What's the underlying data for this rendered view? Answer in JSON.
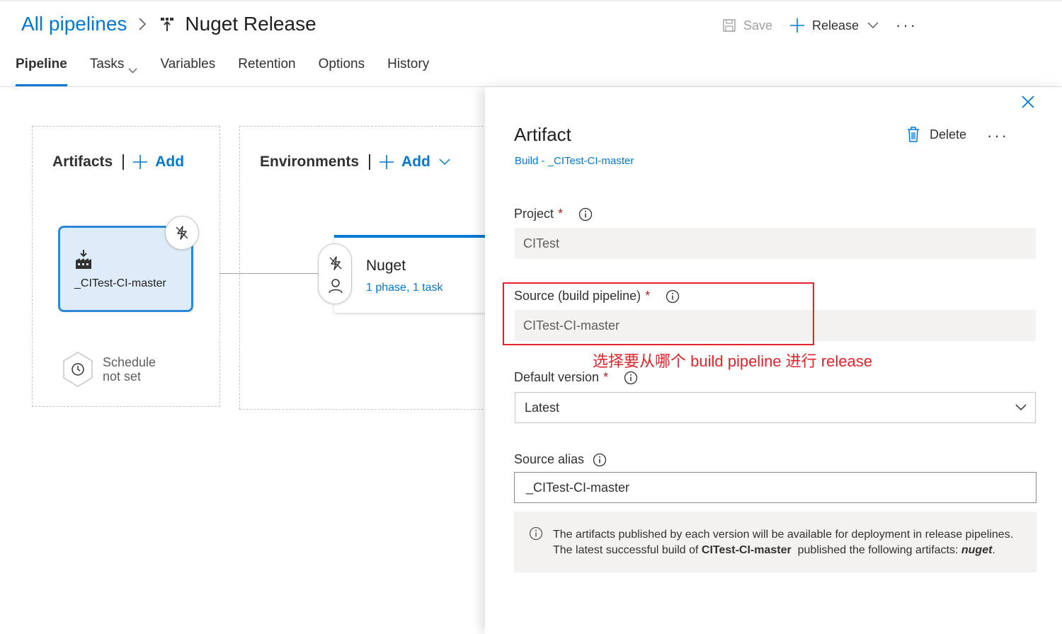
{
  "breadcrumb": {
    "root": "All pipelines",
    "title": "Nuget Release",
    "title_icon": "release-pipeline-icon"
  },
  "toolbar": {
    "save_label": "Save",
    "release_label": "Release",
    "more_label": "···"
  },
  "tabs": [
    {
      "label": "Pipeline",
      "active": true
    },
    {
      "label": "Tasks",
      "active": false,
      "dropdown": true
    },
    {
      "label": "Variables",
      "active": false
    },
    {
      "label": "Retention",
      "active": false
    },
    {
      "label": "Options",
      "active": false
    },
    {
      "label": "History",
      "active": false
    }
  ],
  "artifacts_panel": {
    "title": "Artifacts",
    "add_label": "Add",
    "artifact_name": "_CITest-CI-master",
    "schedule_line1": "Schedule",
    "schedule_line2": "not set"
  },
  "environments_panel": {
    "title": "Environments",
    "add_label": "Add",
    "env_name": "Nuget",
    "env_sub": "1 phase, 1 task"
  },
  "side_panel": {
    "title": "Artifact",
    "subtitle": "Build - _CITest-CI-master",
    "delete_label": "Delete",
    "more_label": "···",
    "project_label": "Project",
    "project_value": "CITest",
    "source_label": "Source (build pipeline)",
    "source_value": "CITest-CI-master",
    "annotation": "选择要从哪个 build pipeline 进行 release",
    "default_version_label": "Default version",
    "default_version_value": "Latest",
    "source_alias_label": "Source alias",
    "source_alias_value": "_CITest-CI-master",
    "info_line1": "The artifacts published by each version will be available for deployment in release pipelines.",
    "info_line2_prefix": "The latest successful build of",
    "info_line2_build": "CITest-CI-master",
    "info_line2_mid": "published the following artifacts:",
    "info_line2_artifact": "nuget",
    "info_line2_end": ".",
    "required_mark": "*"
  },
  "colors": {
    "accent": "#0078d4",
    "annotation": "#e3242b",
    "required": "#a4262c"
  }
}
